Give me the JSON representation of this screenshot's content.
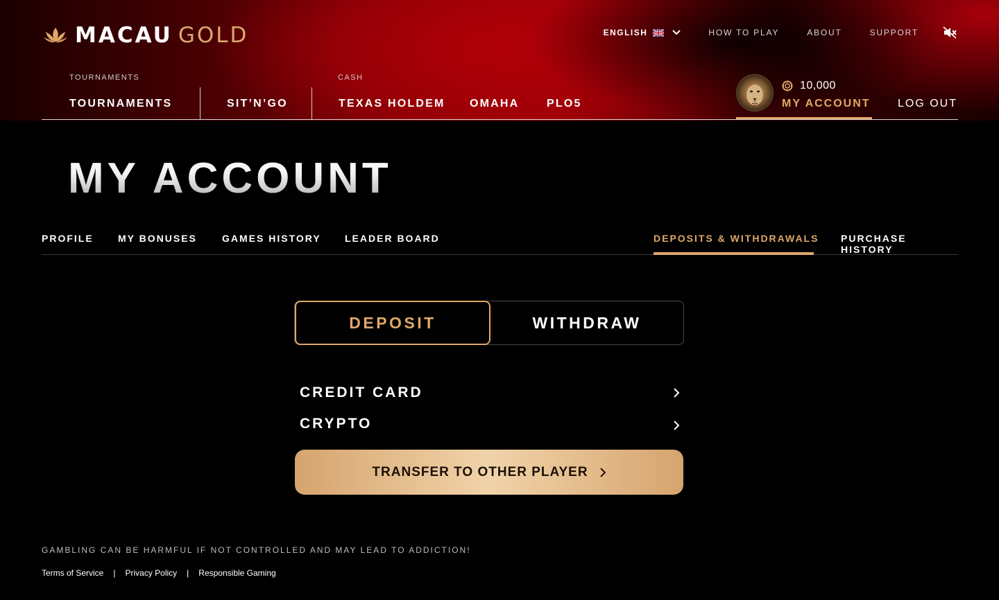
{
  "brand": {
    "name_primary": "MACAU",
    "name_secondary": "GOLD"
  },
  "topnav": {
    "language": "ENGLISH",
    "links": [
      "HOW TO PLAY",
      "ABOUT",
      "SUPPORT"
    ]
  },
  "mainnav": {
    "tournaments_category": "TOURNAMENTS",
    "cash_category": "CASH",
    "items": [
      "TOURNAMENTS",
      "SIT’N’GO",
      "TEXAS HOLDEM",
      "OMAHA",
      "PLO5"
    ]
  },
  "user": {
    "balance": "10,000",
    "account_link": "MY ACCOUNT",
    "logout": "LOG OUT"
  },
  "page": {
    "title": "MY ACCOUNT"
  },
  "tabs": {
    "items": [
      "PROFILE",
      "MY BONUSES",
      "GAMES HISTORY",
      "LEADER BOARD",
      "DEPOSITS & WITHDRAWALS",
      "PURCHASE HISTORY"
    ],
    "active": "DEPOSITS & WITHDRAWALS"
  },
  "segmented": {
    "deposit": "DEPOSIT",
    "withdraw": "WITHDRAW",
    "selected": "DEPOSIT"
  },
  "methods": [
    "CREDIT CARD",
    "CRYPTO"
  ],
  "transfer_button": "TRANSFER TO OTHER PLAYER",
  "footer": {
    "disclaimer": "GAMBLING CAN BE HARMFUL IF NOT CONTROLLED AND MAY LEAD TO ADDICTION!",
    "links": [
      "Terms of Service",
      "Privacy Policy",
      "Responsible Gaming"
    ],
    "separator": "|"
  },
  "colors": {
    "accent_gold": "#e0a869",
    "header_red": "#b10008",
    "background": "#000000"
  },
  "icons": {
    "logo": "lotus-icon",
    "language_flag": "uk-flag-icon",
    "language_dropdown": "chevron-down-icon",
    "sound": "speaker-muted-icon",
    "balance": "chip-icon",
    "method_arrow": "chevron-right-icon"
  }
}
